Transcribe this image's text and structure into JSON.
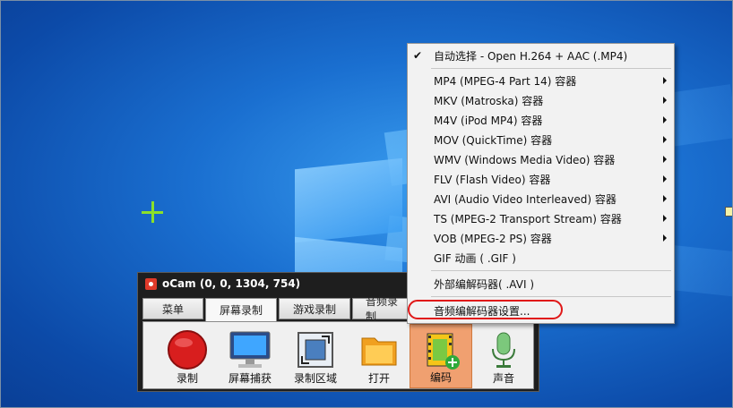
{
  "ocam": {
    "title": "oCam (0, 0, 1304, 754)",
    "tabs": [
      {
        "label": "菜单"
      },
      {
        "label": "屏幕录制"
      },
      {
        "label": "游戏录制"
      },
      {
        "label": "音频录制"
      }
    ],
    "tools": [
      {
        "label": "录制",
        "icon": "record-icon"
      },
      {
        "label": "屏幕捕获",
        "icon": "monitor-icon"
      },
      {
        "label": "录制区域",
        "icon": "record-area-icon"
      },
      {
        "label": "打开",
        "icon": "folder-icon"
      },
      {
        "label": "编码",
        "icon": "codec-film-icon"
      },
      {
        "label": "声音",
        "icon": "microphone-icon"
      }
    ]
  },
  "menu": {
    "items": [
      {
        "label": "自动选择 - Open H.264 + AAC (.MP4)",
        "checked": true,
        "submenu": false
      },
      {
        "label": "MP4 (MPEG-4 Part 14) 容器",
        "checked": false,
        "submenu": true
      },
      {
        "label": "MKV (Matroska) 容器",
        "checked": false,
        "submenu": true
      },
      {
        "label": "M4V (iPod MP4) 容器",
        "checked": false,
        "submenu": true
      },
      {
        "label": "MOV (QuickTime) 容器",
        "checked": false,
        "submenu": true
      },
      {
        "label": "WMV (Windows Media Video) 容器",
        "checked": false,
        "submenu": true
      },
      {
        "label": "FLV (Flash Video) 容器",
        "checked": false,
        "submenu": true
      },
      {
        "label": "AVI (Audio Video Interleaved) 容器",
        "checked": false,
        "submenu": true
      },
      {
        "label": "TS (MPEG-2 Transport Stream) 容器",
        "checked": false,
        "submenu": true
      },
      {
        "label": "VOB (MPEG-2 PS) 容器",
        "checked": false,
        "submenu": true
      },
      {
        "label": "GIF 动画 ( .GIF )",
        "checked": false,
        "submenu": false
      },
      {
        "label": "外部编解码器( .AVI )",
        "checked": false,
        "submenu": false
      },
      {
        "label": "音频编解码器设置...",
        "checked": false,
        "submenu": false
      }
    ],
    "check_glyph": "✔"
  },
  "colors": {
    "desktop": "#1a6fd0",
    "selected_tool": "#f0a070",
    "highlight": "#e01818",
    "crosshair": "#8be02a"
  }
}
